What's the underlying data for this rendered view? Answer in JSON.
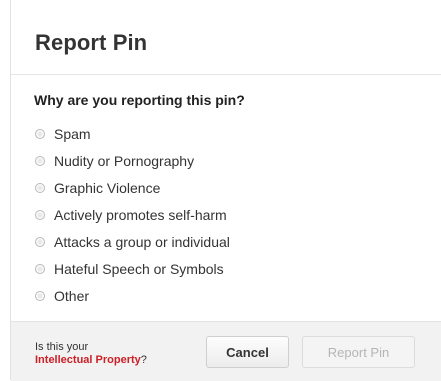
{
  "dialog": {
    "title": "Report Pin",
    "question": "Why are you reporting this pin?",
    "options": [
      {
        "label": "Spam"
      },
      {
        "label": "Nudity or Pornography"
      },
      {
        "label": "Graphic Violence"
      },
      {
        "label": "Actively promotes self-harm"
      },
      {
        "label": "Attacks a group or individual"
      },
      {
        "label": "Hateful Speech or Symbols"
      },
      {
        "label": "Other"
      }
    ],
    "footer": {
      "ip_prefix": "Is this your",
      "ip_link": "Intellectual Property",
      "ip_suffix": "?",
      "cancel_label": "Cancel",
      "report_label": "Report Pin"
    }
  }
}
